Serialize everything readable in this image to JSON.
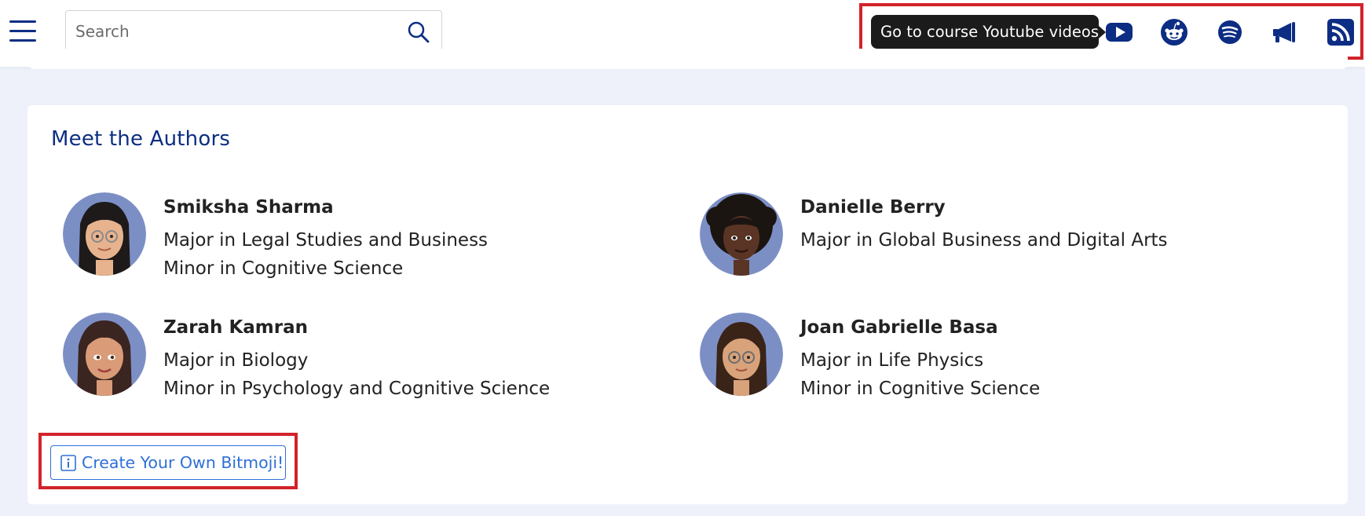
{
  "header": {
    "menu_icon": "hamburger-menu-icon",
    "search": {
      "placeholder": "Search",
      "value": "",
      "icon": "search-icon"
    },
    "tooltip": "Go to course Youtube videos",
    "icons": [
      "youtube-icon",
      "reddit-icon",
      "spotify-icon",
      "megaphone-icon",
      "rss-icon"
    ]
  },
  "colors": {
    "brand": "#0c2d83",
    "accent": "#2f6fd6",
    "highlight": "#d2232a",
    "background": "#eef1fa"
  },
  "authors_section": {
    "title": "Meet the Authors",
    "authors": [
      {
        "name": "Smiksha Sharma",
        "lines": [
          "Major in Legal Studies and Business",
          "Minor in Cognitive Science"
        ]
      },
      {
        "name": "Danielle Berry",
        "lines": [
          "Major in Global Business and Digital Arts"
        ]
      },
      {
        "name": "Zarah Kamran",
        "lines": [
          "Major in Biology",
          "Minor in Psychology and Cognitive Science"
        ]
      },
      {
        "name": "Joan Gabrielle Basa",
        "lines": [
          "Major in Life Physics",
          "Minor in Cognitive Science"
        ]
      }
    ],
    "bitmoji_button": "Create Your Own Bitmoji!"
  }
}
